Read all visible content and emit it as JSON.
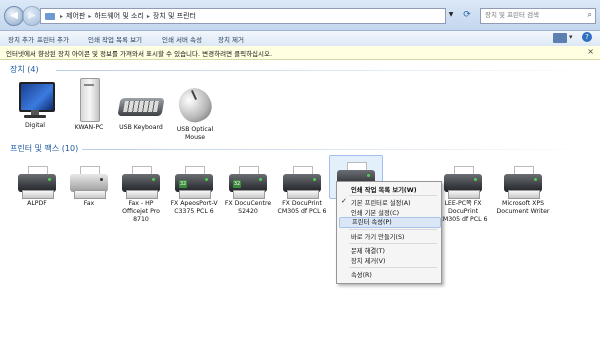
{
  "address": {
    "segments": [
      "제어판",
      "하드웨어 및 소리",
      "장치 및 프린터"
    ],
    "search_placeholder": "장치 및 프린터 검색"
  },
  "toolbar": {
    "items": [
      "장치 추가",
      "프린터 추가",
      "인쇄 작업 목록 보기",
      "인쇄 서버 속성",
      "장치 제거"
    ]
  },
  "infobar": {
    "text": "인터넷에서 향상된 장치 아이콘 및 정보를 가져와서 표시할 수 있습니다. 변경하려면 클릭하십시오.",
    "close": "×"
  },
  "devices": {
    "header": "장치 (4)",
    "items": [
      {
        "label": "Digital",
        "icon": "monitor-icon"
      },
      {
        "label": "KWAN-PC",
        "icon": "computer-tower-icon"
      },
      {
        "label": "USB Keyboard",
        "icon": "keyboard-icon"
      },
      {
        "label": "USB Optical Mouse",
        "icon": "mouse-icon"
      }
    ]
  },
  "printers": {
    "header": "프린터 및 팩스 (10)",
    "items": [
      {
        "label": "ALPDF",
        "icon": "printer-icon"
      },
      {
        "label": "Fax",
        "icon": "fax-icon"
      },
      {
        "label": "Fax - HP Officejet Pro 8710",
        "icon": "printer-icon"
      },
      {
        "label": "FX ApeosPort-V C3375 PCL 6",
        "icon": "printer-icon"
      },
      {
        "label": "FX DocuCentre S2420",
        "icon": "printer-icon"
      },
      {
        "label": "FX DocuPrint CM305 df PCL 6",
        "icon": "printer-icon"
      },
      {
        "label": "LEE-PC쪽 FX DocuPrint CM305 df PCL 6",
        "icon": "printer-icon"
      },
      {
        "label": "Microsoft XPS Document Writer",
        "icon": "printer-icon"
      }
    ]
  },
  "context_menu": {
    "items": [
      "인쇄 작업 목록 보기(W)",
      "기본 프린터로 설정(A)",
      "인쇄 기본 설정(C)",
      "프린터 속성(P)",
      "바로 가기 만들기(S)",
      "문제 해결(T)",
      "장치 제거(V)",
      "속성(R)"
    ],
    "checked": "기본 프린터로 설정(A)",
    "highlighted": "프린터 속성(P)"
  }
}
